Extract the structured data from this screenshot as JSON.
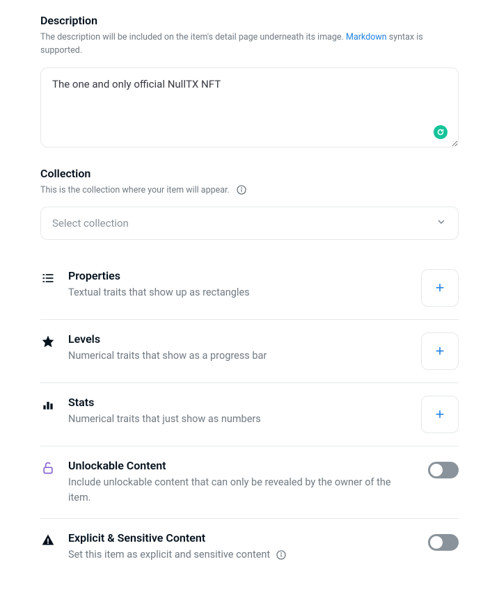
{
  "description": {
    "title": "Description",
    "subtitle_prefix": "The description will be included on the item's detail page underneath its image. ",
    "markdown_link": "Markdown",
    "subtitle_suffix": " syntax is supported.",
    "value": "The one and only official NullTX NFT"
  },
  "collection": {
    "title": "Collection",
    "subtitle": "This is the collection where your item will appear.",
    "placeholder": "Select collection"
  },
  "traits": {
    "properties": {
      "title": "Properties",
      "desc": "Textual traits that show up as rectangles"
    },
    "levels": {
      "title": "Levels",
      "desc": "Numerical traits that show as a progress bar"
    },
    "stats": {
      "title": "Stats",
      "desc": "Numerical traits that just show as numbers"
    },
    "unlockable": {
      "title": "Unlockable Content",
      "desc": "Include unlockable content that can only be revealed by the owner of the item."
    },
    "explicit": {
      "title": "Explicit & Sensitive Content",
      "desc": "Set this item as explicit and sensitive content"
    }
  },
  "icons": {
    "plus": "+"
  }
}
